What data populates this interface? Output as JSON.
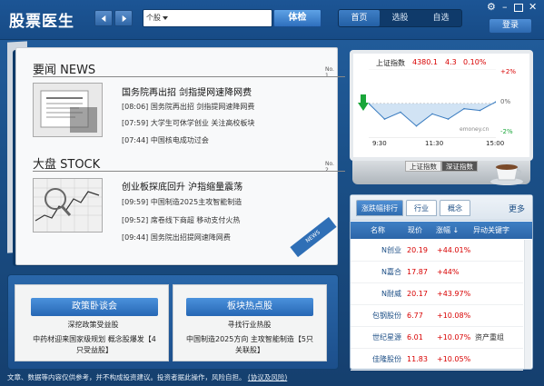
{
  "app": {
    "title": "股票医生"
  },
  "toolbar": {
    "search_scope": "个股",
    "search_placeholder": "",
    "check_button": "体检",
    "nav": [
      "首页",
      "选股",
      "自选"
    ],
    "login": "登录"
  },
  "news": {
    "section1": {
      "title": "要闻 NEWS",
      "no": "No. 1",
      "lead": "国务院再出招 剑指提网速降网费",
      "items": [
        {
          "time": "[08:06]",
          "text": "国务院再出招 剑指提网速降网费"
        },
        {
          "time": "[07:59]",
          "text": "大学生可休学创业 关注高校板块"
        },
        {
          "time": "[07:44]",
          "text": "中国核电成功过会"
        }
      ]
    },
    "section2": {
      "title": "大盘 STOCK",
      "no": "No. 2",
      "lead": "创业板探底回升 沪指缩量震荡",
      "items": [
        {
          "time": "[09:59]",
          "text": "中国制造2025主攻智能制造"
        },
        {
          "time": "[09:52]",
          "text": "席卷线下商超 移动支付火热"
        },
        {
          "time": "[09:44]",
          "text": "国务院出招提网速降网费"
        }
      ]
    },
    "ribbon": "NEWS"
  },
  "book": {
    "left": {
      "button": "政策卧谈会",
      "subtitle": "深挖政策受益股",
      "desc": "中药材迎来国家级规划 概念股爆发【4只受益股】"
    },
    "right": {
      "button": "板块热点股",
      "subtitle": "寻找行业热股",
      "desc": "中国制造2025方向 主攻智能制造【5只关联股】"
    }
  },
  "disclaimer": {
    "text": "文章、数据等内容仅供参考，并不构成投资建议。投资者据此操作，风险自担。",
    "link": "(协议及风险)"
  },
  "index_chart": {
    "name": "上证指数",
    "value": "4380.1",
    "change": "4.3",
    "pct": "0.10%",
    "right_labels": [
      "+2%",
      "0%",
      "-2%"
    ],
    "watermark": "emoney.cn",
    "tabs": [
      "上证指数",
      "深证指数"
    ]
  },
  "chart_data": {
    "type": "line",
    "title": "上证指数",
    "x": [
      "9:30",
      "10:00",
      "10:30",
      "11:00",
      "11:30",
      "13:30",
      "14:00",
      "14:30",
      "15:00"
    ],
    "y_pct": [
      0.0,
      -0.9,
      -0.5,
      -1.3,
      -0.6,
      -0.9,
      -0.3,
      -0.4,
      0.1
    ],
    "xticks": [
      "9:30",
      "11:30",
      "15:00"
    ],
    "ylim": [
      -2,
      2
    ],
    "yticks": [
      "+2%",
      "0%",
      "-2%"
    ]
  },
  "hotlist": {
    "tabs": [
      "涨跌幅排行",
      "行业",
      "概念"
    ],
    "more": "更多",
    "headers": [
      "名称",
      "现价",
      "涨幅",
      "异动关键字"
    ],
    "rows": [
      {
        "name": "N创业",
        "price": "20.19",
        "pct": "+44.01%",
        "kw": ""
      },
      {
        "name": "N嘉合",
        "price": "17.87",
        "pct": "+44%",
        "kw": ""
      },
      {
        "name": "N耐威",
        "price": "20.17",
        "pct": "+43.97%",
        "kw": ""
      },
      {
        "name": "包钢股份",
        "price": "6.77",
        "pct": "+10.08%",
        "kw": ""
      },
      {
        "name": "世纪星源",
        "price": "6.01",
        "pct": "+10.07%",
        "kw": "资产重组"
      },
      {
        "name": "佳隆股份",
        "price": "11.83",
        "pct": "+10.05%",
        "kw": ""
      }
    ]
  },
  "colors": {
    "accent": "#2f6fb6",
    "up": "#d80000",
    "down": "#1aa63a",
    "bg": "#1d5c9a"
  }
}
